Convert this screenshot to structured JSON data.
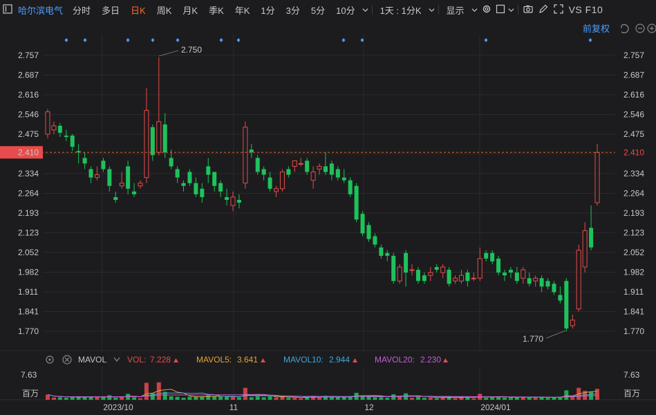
{
  "toolbar": {
    "stock_name": "哈尔滨电气",
    "periods": [
      "分时",
      "多日",
      "日K",
      "周K",
      "月K",
      "季K",
      "年K",
      "1分",
      "3分",
      "5分",
      "10分"
    ],
    "active_period": "日K",
    "dropdown_interval": "1天 : 1分K",
    "display_label": "显示",
    "right_text": "VS F10"
  },
  "header": {
    "restore_label": "前复权"
  },
  "colors": {
    "up": "#e84b4b",
    "down": "#1ec25c",
    "price_line": "#d86a2a",
    "accent": "#4a9eff"
  },
  "chart_data": {
    "type": "candlestick",
    "y_ticks": [
      "2.757",
      "2.687",
      "2.616",
      "2.546",
      "2.475",
      "2.410",
      "2.334",
      "2.264",
      "2.193",
      "2.123",
      "2.052",
      "1.982",
      "1.911",
      "1.841",
      "1.770"
    ],
    "ylim": [
      1.77,
      2.757
    ],
    "current_price": "2.410",
    "x_labels": [
      "2023/10",
      "11",
      "12",
      "2024/01"
    ],
    "annotations": {
      "max": "2.750",
      "min": "1.770"
    },
    "ohlc": [
      [
        2.475,
        2.555,
        2.46,
        2.565
      ],
      [
        2.49,
        2.505,
        2.475,
        2.52
      ],
      [
        2.505,
        2.48,
        2.465,
        2.515
      ],
      [
        2.47,
        2.465,
        2.45,
        2.49
      ],
      [
        2.47,
        2.43,
        2.415,
        2.475
      ],
      [
        2.415,
        2.41,
        2.37,
        2.44
      ],
      [
        2.39,
        2.37,
        2.35,
        2.41
      ],
      [
        2.35,
        2.32,
        2.3,
        2.36
      ],
      [
        2.32,
        2.33,
        2.31,
        2.36
      ],
      [
        2.38,
        2.35,
        2.34,
        2.39
      ],
      [
        2.35,
        2.29,
        2.27,
        2.36
      ],
      [
        2.25,
        2.24,
        2.23,
        2.27
      ],
      [
        2.29,
        2.3,
        2.28,
        2.34
      ],
      [
        2.36,
        2.28,
        2.26,
        2.38
      ],
      [
        2.27,
        2.26,
        2.25,
        2.3
      ],
      [
        2.29,
        2.3,
        2.28,
        2.31
      ],
      [
        2.32,
        2.56,
        2.3,
        2.64
      ],
      [
        2.5,
        2.4,
        2.38,
        2.51
      ],
      [
        2.41,
        2.52,
        2.4,
        2.75
      ],
      [
        2.51,
        2.41,
        2.39,
        2.55
      ],
      [
        2.39,
        2.36,
        2.35,
        2.42
      ],
      [
        2.35,
        2.32,
        2.3,
        2.36
      ],
      [
        2.3,
        2.29,
        2.27,
        2.31
      ],
      [
        2.34,
        2.3,
        2.29,
        2.35
      ],
      [
        2.3,
        2.26,
        2.25,
        2.32
      ],
      [
        2.28,
        2.25,
        2.23,
        2.3
      ],
      [
        2.36,
        2.33,
        2.3,
        2.39
      ],
      [
        2.34,
        2.29,
        2.27,
        2.34
      ],
      [
        2.3,
        2.27,
        2.25,
        2.31
      ],
      [
        2.25,
        2.24,
        2.22,
        2.28
      ],
      [
        2.22,
        2.25,
        2.2,
        2.27
      ],
      [
        2.24,
        2.23,
        2.21,
        2.26
      ],
      [
        2.3,
        2.5,
        2.28,
        2.52
      ],
      [
        2.42,
        2.41,
        2.39,
        2.44
      ],
      [
        2.39,
        2.34,
        2.33,
        2.4
      ],
      [
        2.35,
        2.33,
        2.31,
        2.36
      ],
      [
        2.32,
        2.28,
        2.27,
        2.34
      ],
      [
        2.27,
        2.28,
        2.25,
        2.29
      ],
      [
        2.28,
        2.34,
        2.27,
        2.35
      ],
      [
        2.35,
        2.33,
        2.32,
        2.36
      ],
      [
        2.36,
        2.38,
        2.34,
        2.38
      ],
      [
        2.37,
        2.37,
        2.36,
        2.39
      ],
      [
        2.38,
        2.34,
        2.33,
        2.39
      ],
      [
        2.31,
        2.34,
        2.28,
        2.36
      ],
      [
        2.35,
        2.36,
        2.33,
        2.37
      ],
      [
        2.36,
        2.34,
        2.33,
        2.41
      ],
      [
        2.37,
        2.33,
        2.31,
        2.38
      ],
      [
        2.35,
        2.32,
        2.31,
        2.36
      ],
      [
        2.32,
        2.31,
        2.3,
        2.35
      ],
      [
        2.31,
        2.26,
        2.25,
        2.32
      ],
      [
        2.29,
        2.17,
        2.16,
        2.3
      ],
      [
        2.19,
        2.12,
        2.11,
        2.2
      ],
      [
        2.15,
        2.1,
        2.09,
        2.16
      ],
      [
        2.11,
        2.08,
        2.07,
        2.12
      ],
      [
        2.07,
        2.04,
        2.03,
        2.08
      ],
      [
        2.05,
        2.04,
        2.02,
        2.06
      ],
      [
        2.04,
        1.95,
        1.94,
        2.05
      ],
      [
        1.95,
        2.0,
        1.94,
        2.01
      ],
      [
        2.05,
        1.98,
        1.93,
        2.06
      ],
      [
        1.99,
        1.99,
        1.97,
        2.01
      ],
      [
        1.99,
        1.95,
        1.94,
        2.0
      ],
      [
        1.97,
        1.95,
        1.94,
        1.98
      ],
      [
        1.97,
        1.98,
        1.95,
        2.0
      ],
      [
        2.0,
        1.99,
        1.98,
        2.01
      ],
      [
        1.98,
        2.0,
        1.96,
        2.01
      ],
      [
        1.99,
        1.94,
        1.93,
        2.0
      ],
      [
        1.95,
        1.96,
        1.94,
        1.97
      ],
      [
        1.95,
        1.97,
        1.94,
        1.99
      ],
      [
        1.98,
        1.95,
        1.93,
        1.99
      ],
      [
        1.96,
        1.96,
        1.95,
        1.98
      ],
      [
        1.96,
        2.03,
        1.95,
        2.07
      ],
      [
        2.05,
        2.03,
        2.02,
        2.06
      ],
      [
        2.05,
        2.02,
        2.01,
        2.06
      ],
      [
        2.03,
        1.98,
        1.97,
        2.04
      ],
      [
        1.98,
        1.97,
        1.95,
        1.99
      ],
      [
        1.99,
        1.98,
        1.96,
        2.0
      ],
      [
        1.98,
        1.95,
        1.94,
        2.0
      ],
      [
        1.96,
        1.99,
        1.94,
        2.0
      ],
      [
        1.96,
        1.94,
        1.93,
        1.98
      ],
      [
        1.95,
        1.96,
        1.93,
        1.97
      ],
      [
        1.96,
        1.93,
        1.91,
        1.97
      ],
      [
        1.95,
        1.93,
        1.92,
        1.96
      ],
      [
        1.94,
        1.91,
        1.9,
        1.95
      ],
      [
        1.9,
        1.88,
        1.87,
        1.93
      ],
      [
        1.95,
        1.78,
        1.77,
        1.96
      ],
      [
        1.79,
        1.81,
        1.78,
        1.83
      ],
      [
        1.85,
        2.06,
        1.84,
        2.08
      ],
      [
        2.0,
        2.13,
        1.98,
        2.16
      ],
      [
        2.14,
        2.07,
        2.06,
        2.22
      ],
      [
        2.23,
        2.41,
        2.22,
        2.44
      ]
    ],
    "volume_label_top": "7.63",
    "volume_unit": "百万",
    "volume_indicator": {
      "name": "MAVOL",
      "vol": {
        "label": "VOL:",
        "value": "7.228"
      },
      "ma5": {
        "label": "MAVOL5:",
        "value": "3.641"
      },
      "ma10": {
        "label": "MAVOL10:",
        "value": "2.944"
      },
      "ma20": {
        "label": "MAVOL20:",
        "value": "2.230"
      }
    }
  }
}
